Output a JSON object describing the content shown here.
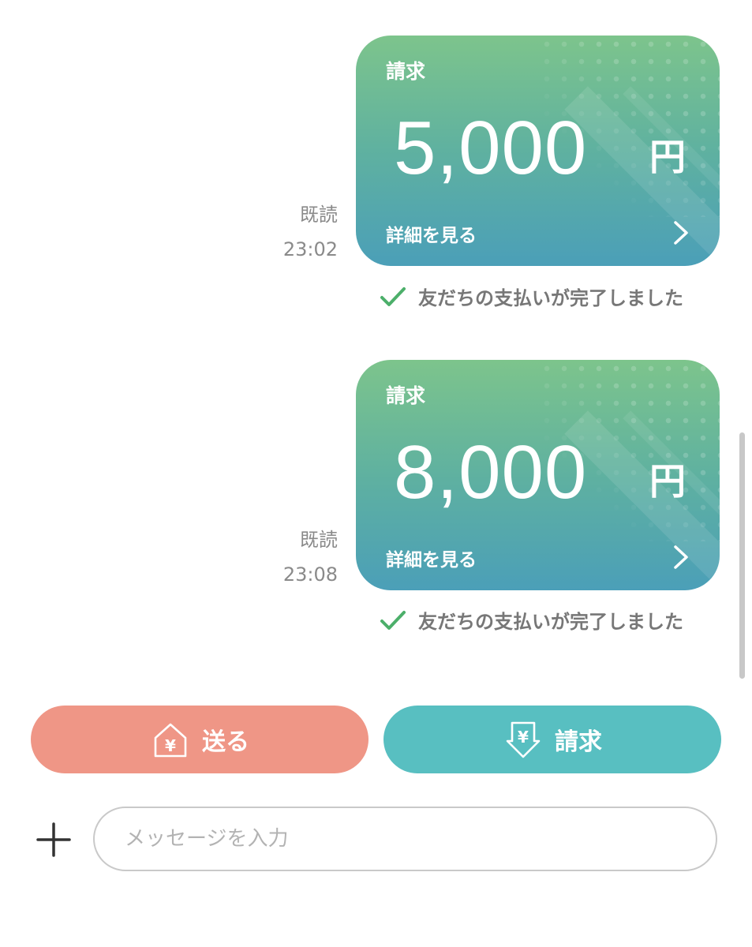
{
  "messages": [
    {
      "read_label": "既読",
      "time": "23:02",
      "card": {
        "title": "請求",
        "amount": "5,000",
        "unit": "円",
        "detail_label": "詳細を見る"
      },
      "status_text": "友だちの支払いが完了しました"
    },
    {
      "read_label": "既読",
      "time": "23:08",
      "card": {
        "title": "請求",
        "amount": "8,000",
        "unit": "円",
        "detail_label": "詳細を見る"
      },
      "status_text": "友だちの支払いが完了しました"
    }
  ],
  "actions": {
    "send_label": "送る",
    "request_label": "請求"
  },
  "composer": {
    "placeholder": "メッセージを入力",
    "value": ""
  },
  "colors": {
    "card_gradient_top": "#7dc48c",
    "card_gradient_bottom": "#4b9fb8",
    "send_button": "#ef9686",
    "request_button": "#58bfc1",
    "check_green": "#4caf6a"
  },
  "icons": {
    "send": "yen-house-icon",
    "request": "yen-down-arrow-icon",
    "status": "check-icon",
    "detail": "chevron-right-icon",
    "attach": "plus-icon"
  }
}
